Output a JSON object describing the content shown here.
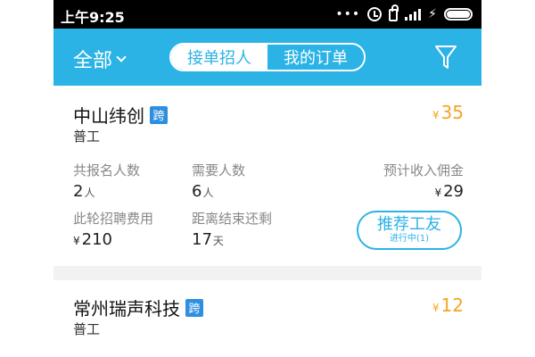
{
  "status_bar": {
    "time": "上午9:25",
    "dots": "•••",
    "icons": [
      "alarm-icon",
      "lock-icon",
      "signal-icon",
      "bolt-icon",
      "battery-icon"
    ]
  },
  "header": {
    "filter_label": "全部",
    "tabs": [
      {
        "label": "接单招人",
        "active": false
      },
      {
        "label": "我的订单",
        "active": true
      }
    ],
    "filter_icon": "filter-icon",
    "accent_color": "#2bb3e6"
  },
  "cards": [
    {
      "company": "中山纬创",
      "badge": "跨",
      "job_type": "普工",
      "price_symbol": "¥",
      "price": "35",
      "stats": {
        "registered_label": "共报名人数",
        "registered_value": "2",
        "registered_unit": "人",
        "needed_label": "需要人数",
        "needed_value": "6",
        "needed_unit": "人",
        "commission_label": "预计收入佣金",
        "commission_symbol": "¥",
        "commission_value": "29",
        "fee_label": "此轮招聘费用",
        "fee_symbol": "¥",
        "fee_value": "210",
        "remaining_label": "距离结束还剩",
        "remaining_value": "17",
        "remaining_unit": "天"
      },
      "button_label": "推荐工友",
      "button_sub": "进行中(1)"
    },
    {
      "company": "常州瑞声科技",
      "badge": "跨",
      "job_type": "普工",
      "price_symbol": "¥",
      "price": "12"
    }
  ],
  "colors": {
    "price": "#f5a623",
    "badge": "#2e8fe0"
  }
}
